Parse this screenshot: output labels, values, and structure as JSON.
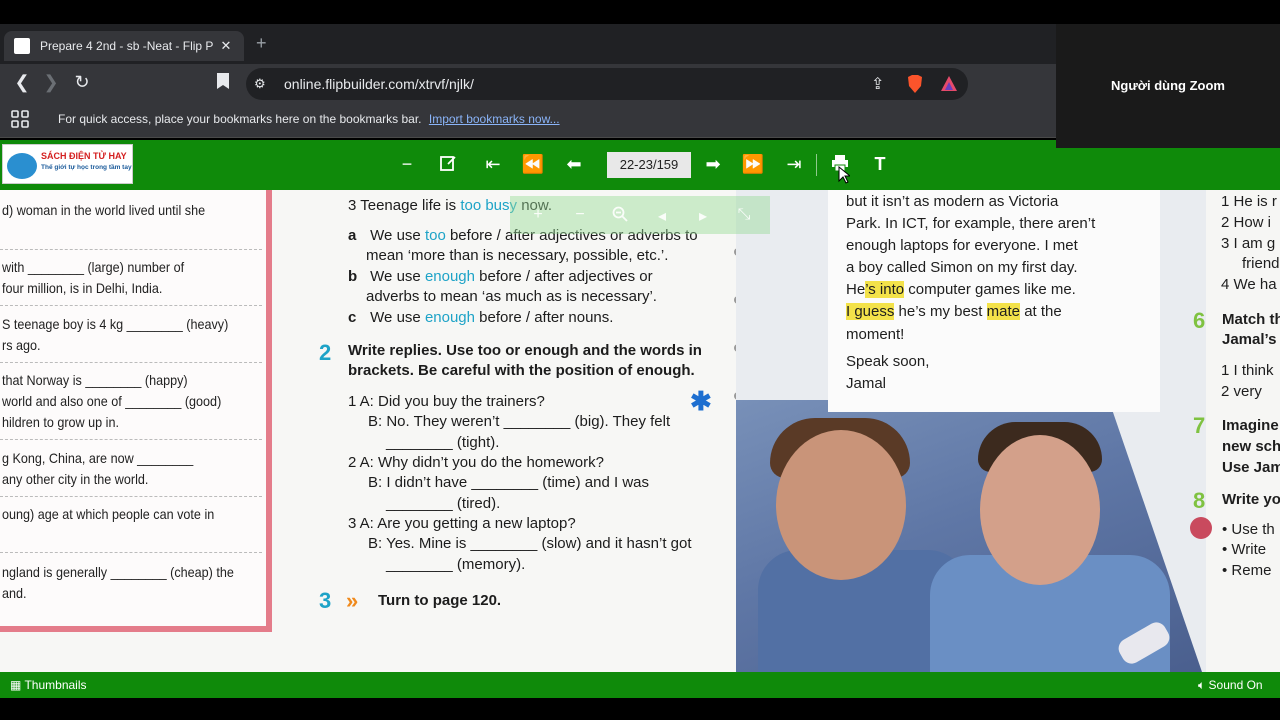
{
  "browser": {
    "tab_title": "Prepare 4 2nd - sb -Neat - Flip P",
    "tab_close": "✕",
    "new_tab": "+",
    "url": "online.flipbuilder.com/xtrvf/njlk/",
    "bookmarks_hint": "For quick access, place your bookmarks here on the bookmarks bar.",
    "bookmarks_link": "Import bookmarks now..."
  },
  "zoom": {
    "participant_name": "Người dùng Zoom"
  },
  "flipbook": {
    "logo_title": "SÁCH ĐIỆN TỬ HAY",
    "logo_subtitle": "Thế giới tự học trong tầm tay",
    "page_indicator": "22-23/159",
    "thumbnails_label": "Thumbnails",
    "sound_label": "Sound On"
  },
  "left_column": [
    "d) woman in the world lived until she",
    "with ________ (large) number of",
    "four million, is in Delhi, India.",
    "S teenage boy is 4 kg ________ (heavy)",
    "rs ago.",
    "that Norway is ________ (happy)",
    "world and also one of ________ (good)",
    "hildren to grow up in.",
    "g Kong, China, are now ________",
    "any other city in the world.",
    "oung) age at which people can vote in",
    "ngland is generally ________ (cheap) the",
    "and."
  ],
  "grammar": {
    "line3_prefix": "3  Teenage life is",
    "line3_hl": "too busy",
    "line3_suffix": "now.",
    "a_letter": "a",
    "a_text1": "We use",
    "a_hl": "too",
    "a_text2": "before / after adjectives or adverbs to",
    "a_text3": "mean ‘more than is necessary, possible, etc.’.",
    "b_letter": "b",
    "b_text1": "We use",
    "b_hl": "enough",
    "b_text2": "before / after adjectives or",
    "b_text3": "adverbs to mean ‘as much as is necessary’.",
    "c_letter": "c",
    "c_text1": "We use",
    "c_hl": "enough",
    "c_text2": "before / after nouns."
  },
  "exercise2": {
    "number": "2",
    "heading1": "Write replies. Use too or enough and the words in",
    "heading2": "brackets. Be careful with the position of enough.",
    "q1a": "1  A: Did you buy the trainers?",
    "q1b": "B: No. They weren’t ________ (big). They felt",
    "q1c": "________ (tight).",
    "q2a": "2  A: Why didn’t you do the homework?",
    "q2b": "B: I didn’t have ________ (time) and I was",
    "q2c": "________ (tired).",
    "q3a": "3  A: Are you getting a new laptop?",
    "q3b": "B: Yes. Mine is ________ (slow) and it hasn’t got",
    "q3c": "________ (memory)."
  },
  "exercise3": {
    "number": "3",
    "arrows": "»",
    "text": "Turn to page 120."
  },
  "letter": {
    "l1": "but it isn’t as modern as Victoria",
    "l2": "Park. In ICT, for example, there aren’t",
    "l3": "enough laptops for everyone. I met",
    "l4": "a boy called Simon on my first day.",
    "l5_a": "He",
    "l5_hl": "’s into",
    "l5_b": "computer games like me.",
    "l6_hl": "I guess",
    "l6_a": "he’s my best",
    "l6_hl2": "mate",
    "l6_b": "at the",
    "l7": "moment!",
    "l8": "Speak soon,",
    "l9": "Jamal"
  },
  "far_right": {
    "r1": "1  He is r",
    "r2": "2  How i",
    "r3": "3  I am g",
    "r3b": "friend",
    "r4": "4  We ha",
    "s6": "6",
    "r6a": "Match th",
    "r6b": "Jamal’s",
    "r7": "1  I think",
    "r8": "2  very",
    "s7": "7",
    "r9": "Imagine",
    "r10": "new sch",
    "r11": "Use Jam",
    "s8": "8",
    "r12": "Write yo",
    "r13": "•  Use th",
    "r14": "•  Write",
    "r15": "•  Reme"
  },
  "icons": [
    "back-icon",
    "forward-icon",
    "reload-icon",
    "bookmark-icon",
    "site-info-icon",
    "share-icon",
    "brave-icon",
    "rewards-icon",
    "apps-icon",
    "zoom-out-icon",
    "edit-icon",
    "first-page-icon",
    "prev-fast-icon",
    "prev-page-icon",
    "next-page-icon",
    "next-fast-icon",
    "last-page-icon",
    "print-icon",
    "text-icon",
    "thumbnails-icon",
    "sound-icon"
  ],
  "colors": {
    "accent_green": "#0f8a0a",
    "keyword_blue": "#1ea3c7",
    "highlight_yellow": "#f3e24a"
  }
}
